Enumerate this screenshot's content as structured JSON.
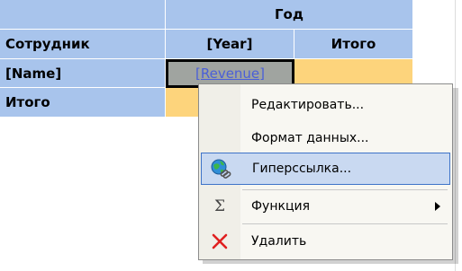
{
  "pivot_table": {
    "year_group_header": "Год",
    "row_header": "Сотрудник",
    "column_year": "[Year]",
    "column_total": "Итого",
    "row_name": "[Name]",
    "revenue_field": "[Revenue]",
    "row_total": "Итого"
  },
  "context_menu": {
    "items": [
      {
        "label": "Редактировать...",
        "icon": ""
      },
      {
        "label": "Формат данных...",
        "icon": ""
      },
      {
        "label": "Гиперссылка...",
        "icon": "hyperlink-globe-icon",
        "highlighted": true
      },
      {
        "label": "Функция",
        "icon": "sigma-icon",
        "has_submenu": true
      },
      {
        "label": "Удалить",
        "icon": "delete-x-icon"
      }
    ],
    "sigma_glyph": "Σ"
  },
  "colors": {
    "header_blue": "#a8c4ec",
    "total_orange": "#fdd47c",
    "selected_cell_gray": "#a0a4a0",
    "link_blue": "#4a5fd8",
    "menu_highlight": "#c9d9f1",
    "menu_highlight_border": "#3e73c8",
    "delete_red": "#e02020"
  }
}
